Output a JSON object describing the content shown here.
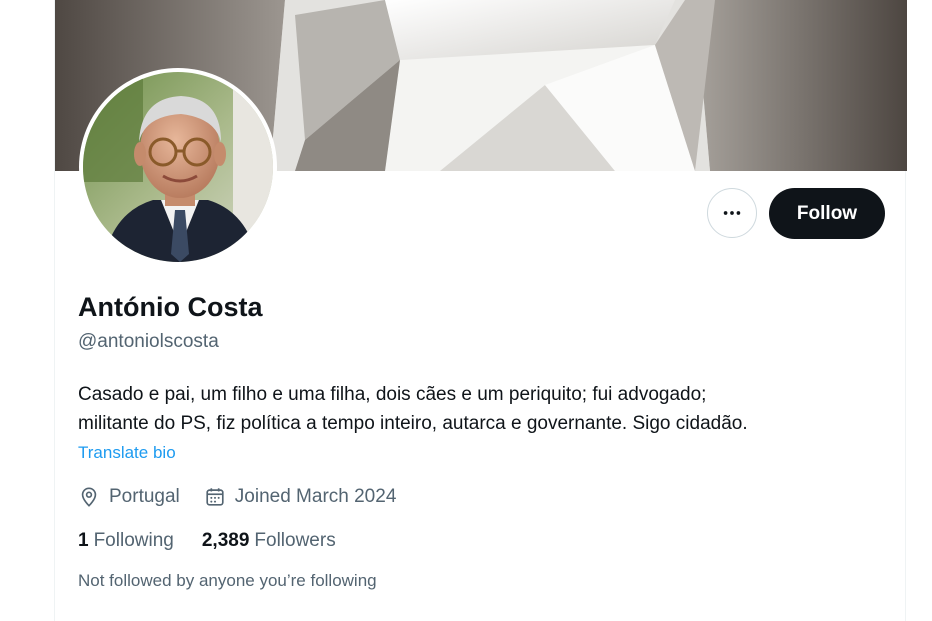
{
  "profile": {
    "display_name": "António Costa",
    "handle": "@antoniolscosta",
    "bio_lines": [
      "Casado e pai, um filho e uma filha, dois cães e um periquito; fui advogado;",
      "militante do PS, fiz política a tempo inteiro, autarca e governante. Sigo cidadão."
    ],
    "translate_label": "Translate bio",
    "location": "Portugal",
    "joined": "Joined March 2024",
    "following_count": "1",
    "following_label": "Following",
    "followers_count": "2,389",
    "followers_label": "Followers",
    "followed_by_text": "Not followed by anyone you’re following"
  },
  "actions": {
    "follow_label": "Follow",
    "more_icon": "more-horizontal-icon"
  },
  "icons": {
    "location": "location-pin-icon",
    "calendar": "calendar-icon"
  },
  "colors": {
    "text_primary": "#0f1419",
    "text_secondary": "#536471",
    "link": "#1d9bf0",
    "follow_button_bg": "#0f1419"
  }
}
